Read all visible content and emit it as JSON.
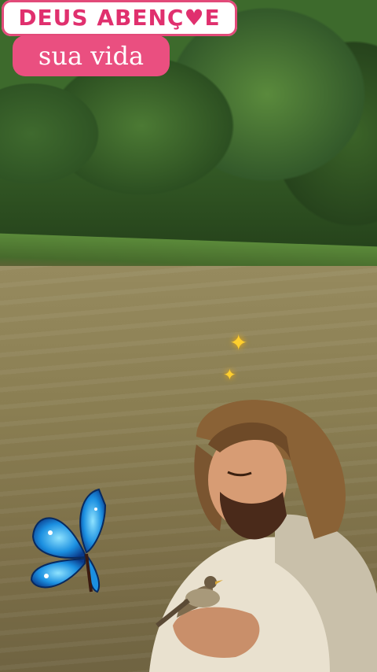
{
  "title": {
    "line1": "DEUS ABENÇ♥E",
    "line2": "sua vida"
  },
  "colors": {
    "title_pink": "#e0306e",
    "badge_pink": "#ea4f80",
    "sparkle": "#ffcf2e"
  },
  "icons": [
    "sparkle-icon",
    "heart-icon",
    "butterfly-icon"
  ]
}
